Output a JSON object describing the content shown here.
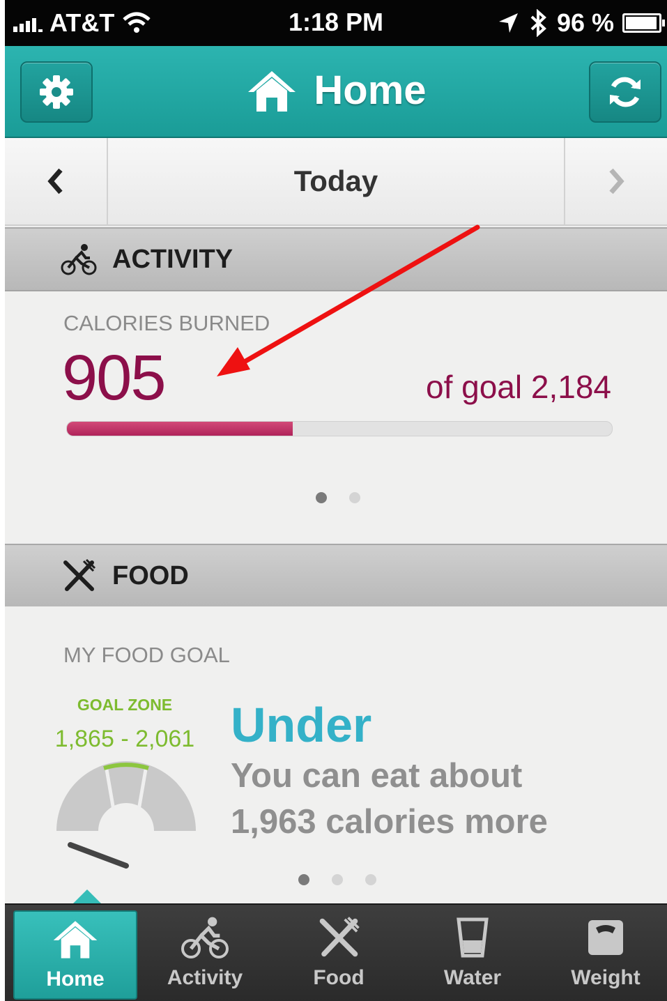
{
  "status_bar": {
    "carrier": "AT&T",
    "time": "1:18 PM",
    "battery": "96 %"
  },
  "header": {
    "title": "Home",
    "accent_color": "#1fa6a1"
  },
  "date_nav": {
    "label": "Today"
  },
  "activity": {
    "section_title": "ACTIVITY",
    "calories_label": "CALORIES BURNED",
    "calories_value": "905",
    "goal_text": "of goal 2,184",
    "progress_fraction": 0.414,
    "page_dots": 2,
    "active_dot": 0
  },
  "food": {
    "section_title": "FOOD",
    "goal_label": "MY FOOD GOAL",
    "zone_title": "GOAL ZONE",
    "zone_range": "1,865 - 2,061",
    "status": "Under",
    "message_line1": "You can eat about",
    "message_line2": "1,963 calories more",
    "page_dots": 3,
    "active_dot": 0
  },
  "tabs": [
    {
      "label": "Home",
      "icon": "home-icon",
      "selected": true
    },
    {
      "label": "Activity",
      "icon": "bike-icon",
      "selected": false
    },
    {
      "label": "Food",
      "icon": "fork-knife-icon",
      "selected": false
    },
    {
      "label": "Water",
      "icon": "glass-icon",
      "selected": false
    },
    {
      "label": "Weight",
      "icon": "scale-icon",
      "selected": false
    }
  ],
  "colors": {
    "calorie_text": "#8c0f4a",
    "progress_fill": "#c0336a",
    "goal_zone_green": "#7dbb2f",
    "under_blue": "#34b1c8",
    "annotation_arrow": "#ee1111"
  }
}
